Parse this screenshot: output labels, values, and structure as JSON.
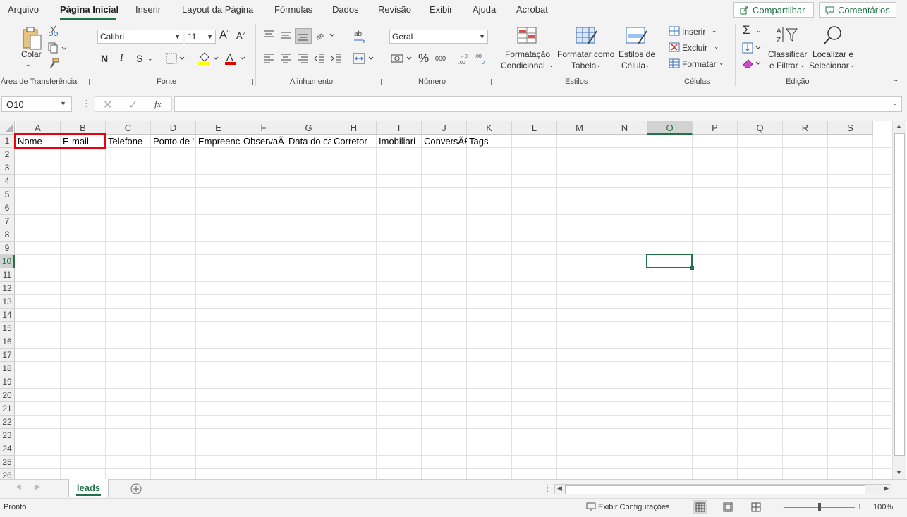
{
  "tabs": [
    "Arquivo",
    "Página Inicial",
    "Inserir",
    "Layout da Página",
    "Fórmulas",
    "Dados",
    "Revisão",
    "Exibir",
    "Ajuda",
    "Acrobat"
  ],
  "share": {
    "label": "Compartilhar"
  },
  "comments": {
    "label": "Comentários"
  },
  "ribbon": {
    "clipboard": {
      "paste": "Colar",
      "label": "Área de Transferência"
    },
    "font": {
      "name": "Calibri",
      "size": "11",
      "bold": "N",
      "italic": "I",
      "underline": "S",
      "label": "Fonte"
    },
    "alignment": {
      "label": "Alinhamento"
    },
    "number": {
      "format": "Geral",
      "label": "Número"
    },
    "styles": {
      "cond1": "Formatação",
      "cond2": "Condicional",
      "table1": "Formatar como",
      "table2": "Tabela",
      "cell1": "Estilos de",
      "cell2": "Célula",
      "label": "Estilos"
    },
    "cells": {
      "insert": "Inserir",
      "delete": "Excluir",
      "format": "Formatar",
      "label": "Células"
    },
    "editing": {
      "sort1": "Classificar",
      "sort2": "e Filtrar",
      "find1": "Localizar e",
      "find2": "Selecionar",
      "label": "Edição"
    }
  },
  "formula_bar": {
    "name_box": "O10",
    "formula": ""
  },
  "grid": {
    "columns": [
      "A",
      "B",
      "C",
      "D",
      "E",
      "F",
      "G",
      "H",
      "I",
      "J",
      "K",
      "L",
      "M",
      "N",
      "O",
      "P",
      "Q",
      "R",
      "S"
    ],
    "rows": [
      "1",
      "2",
      "3",
      "4",
      "5",
      "6",
      "7",
      "8",
      "9",
      "10",
      "11",
      "12",
      "13",
      "14",
      "15",
      "16",
      "17",
      "18",
      "19",
      "20",
      "21",
      "22",
      "23",
      "24",
      "25",
      "26"
    ],
    "headers": [
      "Nome",
      "E-mail",
      "Telefone",
      "Ponto de '",
      "Empreenc",
      "ObservaÃ",
      "Data do ca",
      "Corretor",
      "Imobiliari",
      "ConversÃ£",
      "Tags"
    ],
    "selected_cell": "O10"
  },
  "sheet_tab": {
    "name": "leads"
  },
  "status": {
    "ready": "Pronto",
    "display_settings": "Exibir Configurações",
    "zoom": "100%"
  },
  "colors": {
    "accent": "#217346",
    "highlight_box": "#e8000b"
  }
}
